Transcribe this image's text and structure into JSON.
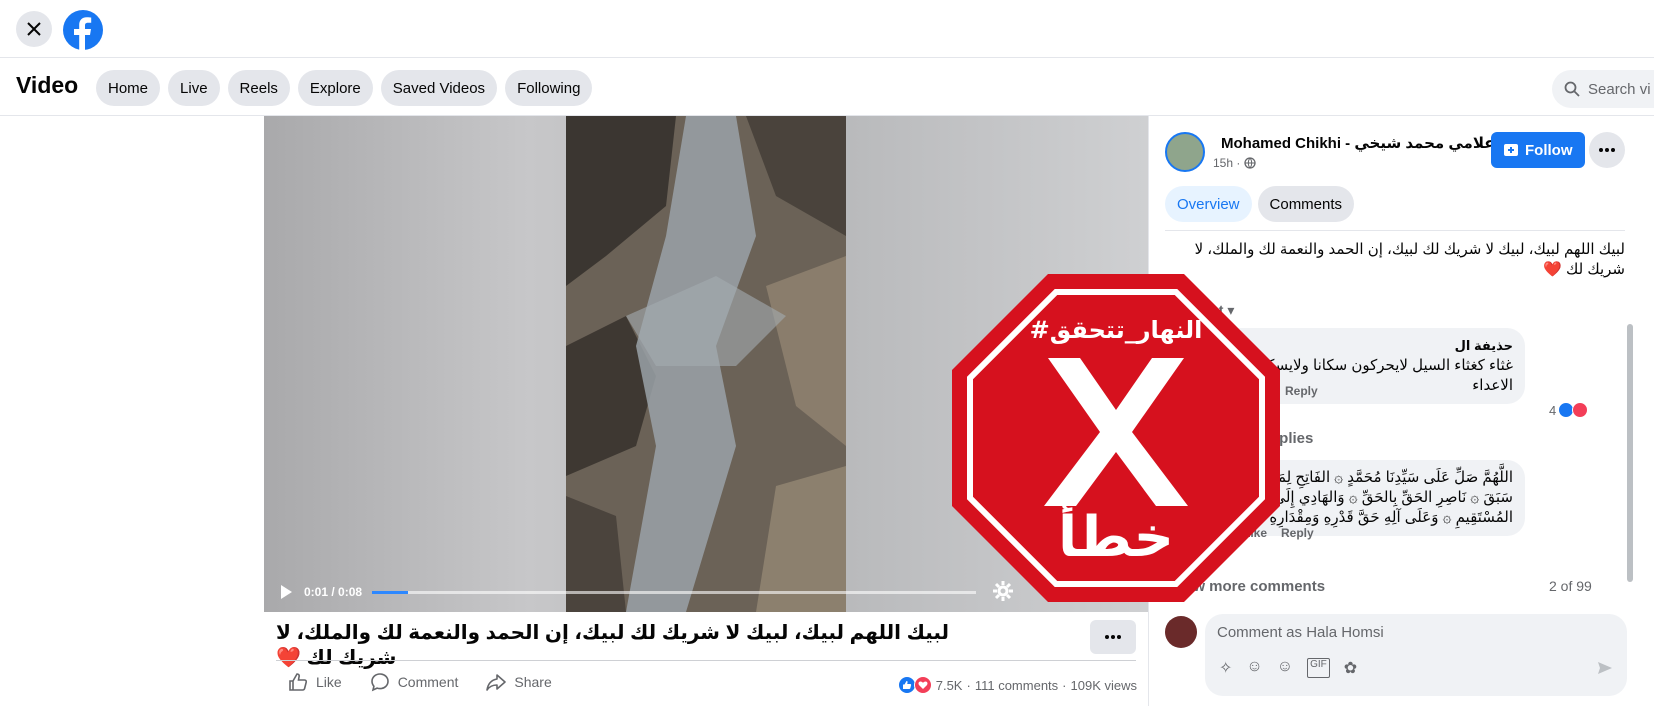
{
  "header": {
    "close_label": "close",
    "brand": "Facebook"
  },
  "nav": {
    "title": "Video",
    "tabs": [
      {
        "label": "Home"
      },
      {
        "label": "Live"
      },
      {
        "label": "Reels"
      },
      {
        "label": "Explore"
      },
      {
        "label": "Saved Videos"
      },
      {
        "label": "Following"
      }
    ],
    "search_placeholder": "Search vi"
  },
  "player": {
    "current_time": "0:01",
    "duration": "0:08",
    "time_display": "0:01 / 0:08",
    "progress_fraction": 0.06
  },
  "post": {
    "caption": "لبيك اللهم لبيك، لبيك لا شريك لك لبيك، إن الحمد والنعمة لك والملك، لا شريك لك ❤️",
    "like_label": "Like",
    "comment_label": "Comment",
    "share_label": "Share",
    "reactions_count": "7.5K",
    "comments_count": "111 comments",
    "views": "109K views"
  },
  "panel": {
    "author": "Mohamed Chikhi - الإعلامي محمد شيخي",
    "time": "15h ·",
    "follow_label": "Follow",
    "tabs": [
      "Overview",
      "Comments"
    ],
    "post_text": "لبيك اللهم لبيك، لبيك لا شريك لك لبيك، إن الحمد والنعمة لك والملك، لا شريك لك ❤️",
    "sort_label": "levant",
    "comments": [
      {
        "name": "حذيفة ال",
        "text": "غثاء كغثاء السيل لايحركون سكانا ولايسكنون متحركا الاعداء",
        "reply_label": "Reply",
        "reactions": "4"
      },
      {
        "text": "اللَّهُمَّ صَلِّ عَلَى سَيِّدِنَا مُحَمَّدٍ ۞ الفَاتِحِ لِمَا أُغْلِقَ ۞ لِمَا سَبَقَ ۞ نَاصِرِ الحَقِّ بِالحَقِّ ۞ وَالهَادِي إِلَى صِرَاطِكَ المُسْتَقِيمِ ۞ وَعَلَى آلِهِ حَقَّ قَدْرِهِ وَمِقْدَارِهِ العَظِيمِ ۞",
        "like_label": "Like",
        "reply_label": "Reply"
      }
    ],
    "replies_label": "replies",
    "view_more_label": "ew more comments",
    "pager": "2 of 99",
    "comment_placeholder": "Comment as Hala Homsi"
  },
  "stamp": {
    "hashtag": "#النهار_تتحقق",
    "verdict": "خطأ",
    "color": "#d6111e"
  }
}
